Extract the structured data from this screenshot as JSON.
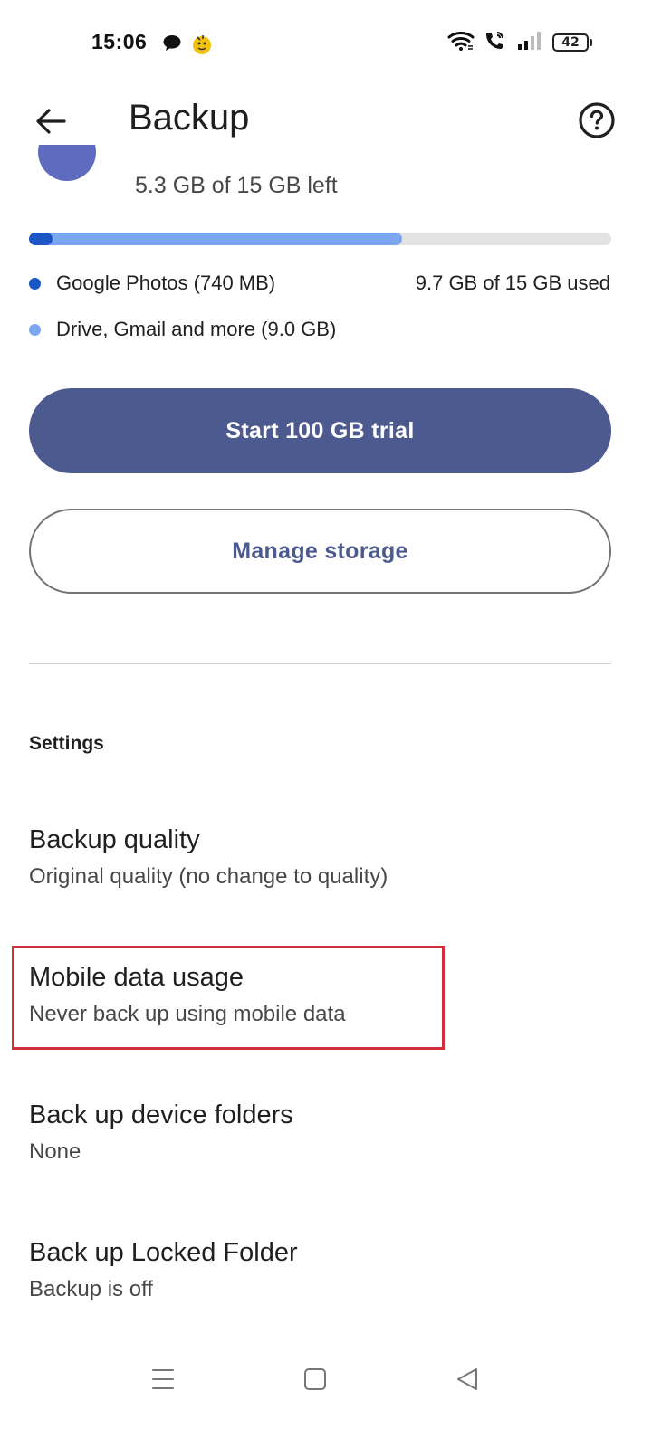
{
  "status_bar": {
    "time": "15:06",
    "battery": "42",
    "icons": [
      "chat-bubble-icon",
      "emoji-notification-icon",
      "wifi-icon",
      "wifi-calling-icon",
      "signal-icon",
      "battery-icon"
    ]
  },
  "app_bar": {
    "title": "Backup",
    "back_icon": "arrow-left-icon",
    "help_icon": "help-circle-icon"
  },
  "storage": {
    "left_text": "5.3 GB of 15 GB left",
    "used_text": "9.7 GB of 15 GB used",
    "photos_fraction": 0.04,
    "drive_fraction": 0.64,
    "legend": [
      {
        "label": "Google Photos (740 MB)",
        "color": "#1a56c4"
      },
      {
        "label": "Drive, Gmail and more (9.0 GB)",
        "color": "#7aa7ef"
      }
    ]
  },
  "buttons": {
    "trial_label": "Start 100 GB trial",
    "manage_label": "Manage storage"
  },
  "settings": {
    "header": "Settings",
    "items": [
      {
        "title": "Backup quality",
        "subtitle": "Original quality (no change to quality)"
      },
      {
        "title": "Mobile data usage",
        "subtitle": "Never back up using mobile data"
      },
      {
        "title": "Back up device folders",
        "subtitle": "None"
      },
      {
        "title": "Back up Locked Folder",
        "subtitle": "Backup is off"
      }
    ]
  },
  "colors": {
    "accent": "#4c5a8f",
    "highlight": "#d32f3a"
  },
  "nav_bar": {
    "icons": [
      "menu-icon",
      "home-square-icon",
      "back-triangle-icon"
    ]
  }
}
